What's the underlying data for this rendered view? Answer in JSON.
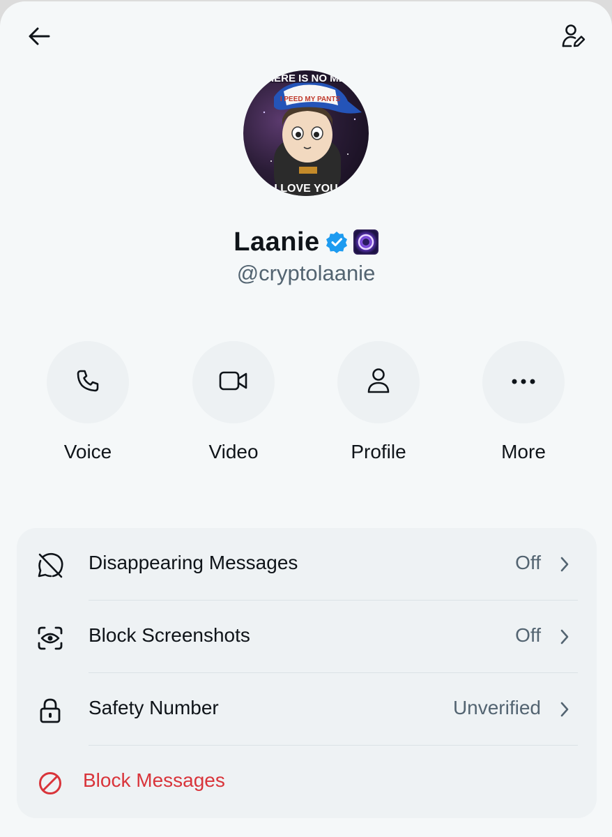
{
  "profile": {
    "display_name": "Laanie",
    "handle": "@cryptolaanie",
    "verified": true,
    "avatar_caption_top": "HERE IS NO ME",
    "avatar_hat_text": "I PEED MY PANTS",
    "avatar_caption_bottom": "I LOVE YOU"
  },
  "header": {
    "back_icon": "arrow-left-icon",
    "edit_icon": "user-edit-icon"
  },
  "actions": [
    {
      "label": "Voice",
      "icon": "phone-icon"
    },
    {
      "label": "Video",
      "icon": "video-camera-icon"
    },
    {
      "label": "Profile",
      "icon": "person-icon"
    },
    {
      "label": "More",
      "icon": "more-dots-icon"
    }
  ],
  "settings": [
    {
      "label": "Disappearing Messages",
      "value": "Off",
      "icon": "disappearing-timer-icon"
    },
    {
      "label": "Block Screenshots",
      "value": "Off",
      "icon": "screenshot-block-icon"
    },
    {
      "label": "Safety Number",
      "value": "Unverified",
      "icon": "lock-icon"
    },
    {
      "label": "Block Messages",
      "icon": "block-icon"
    }
  ],
  "colors": {
    "background": "#f5f8f9",
    "text_primary": "#0f1419",
    "text_secondary": "#536471",
    "verified_blue": "#1d9bf0",
    "danger_red": "#d9343a"
  }
}
